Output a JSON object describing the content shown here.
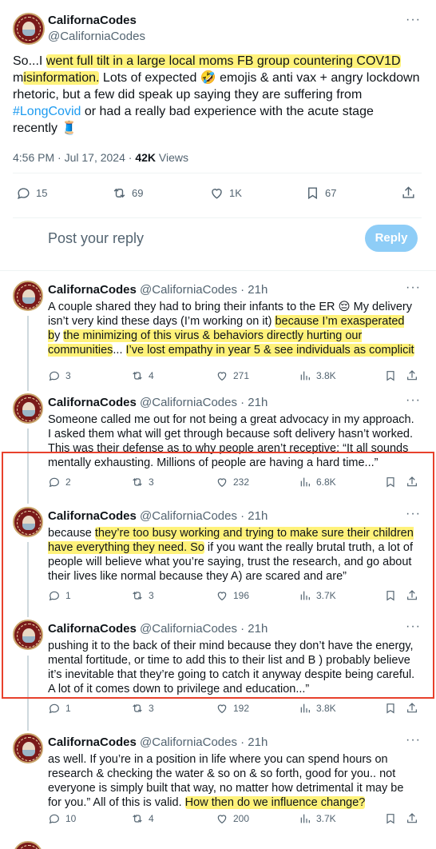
{
  "main_tweet": {
    "name": "CalifornaCodes",
    "handle": "@CaliforniaCodes",
    "text_parts": [
      {
        "t": "So...I ",
        "hl": false
      },
      {
        "t": "went full tilt in a large local moms FB group countering COV1D",
        "hl": true
      },
      {
        "t": " m",
        "hl": false
      },
      {
        "t": "isinformation.",
        "hl": true
      },
      {
        "t": " Lots of expected 🤣 emojis & anti vax + angry lockdown rhetoric, but a few did speak up saying they are suffering from ",
        "hl": false
      },
      {
        "t": "#LongCovid",
        "hl": false,
        "tag": true
      },
      {
        "t": " or had a really bad experience with the acute stage recently 🧵",
        "hl": false
      }
    ],
    "time": "4:56 PM · Jul 17, 2024 · ",
    "views_count": "42K",
    "views_label": " Views",
    "replies": "15",
    "retweets": "69",
    "likes": "1K",
    "bookmarks": "67"
  },
  "reply_box": {
    "placeholder": "Post your reply",
    "button": "Reply"
  },
  "replies": [
    {
      "name": "CalifornaCodes",
      "meta": " @CaliforniaCodes · 21h",
      "parts": [
        {
          "t": "A couple shared they had to bring their infants to the ER 😔 My delivery isn’t very kind these days (I’m working on it) ",
          "hl": false
        },
        {
          "t": "because I’m exasperated b",
          "hl": true
        },
        {
          "t": "y ",
          "hl": false
        },
        {
          "t": "the minimizing of this virus & behaviors directly hurting our communities",
          "hl": true
        },
        {
          "t": "... ",
          "hl": false
        },
        {
          "t": "I’ve lost empathy in year 5 & see individuals as complicit",
          "hl": true
        }
      ],
      "replies": "3",
      "retweets": "4",
      "likes": "271",
      "views": "3.8K"
    },
    {
      "name": "CalifornaCodes",
      "meta": " @CaliforniaCodes · 21h",
      "parts": [
        {
          "t": "Someone called me out for not being a great advocacy in my approach. I asked them what will get through because soft delivery hasn’t worked. This was their defense as to why people aren’t receptive: “It all sounds mentally exhausting. Millions of people are having a hard time...”",
          "hl": false
        }
      ],
      "replies": "2",
      "retweets": "3",
      "likes": "232",
      "views": "6.8K"
    },
    {
      "name": "CalifornaCodes",
      "meta": " @CaliforniaCodes · 21h",
      "parts": [
        {
          "t": "because ",
          "hl": false
        },
        {
          "t": "they’re too busy working and trying to make sure their children have everything they need. So",
          "hl": true
        },
        {
          "t": " if you want the really brutal truth, a lot of people will believe what you’re saying, trust the research, and go about their lives like normal because they A) are scared and are”",
          "hl": false
        }
      ],
      "replies": "1",
      "retweets": "3",
      "likes": "196",
      "views": "3.7K"
    },
    {
      "name": "CalifornaCodes",
      "meta": " @CaliforniaCodes · 21h",
      "parts": [
        {
          "t": "pushing it to the back of their mind because they don’t have the energy, mental fortitude, or time to add this to their list and B ) probably believe it’s inevitable that they’re going to catch it anyway despite being careful. A lot of it comes down to privilege and education...”",
          "hl": false
        }
      ],
      "replies": "1",
      "retweets": "3",
      "likes": "192",
      "views": "3.8K"
    },
    {
      "name": "CalifornaCodes",
      "meta": " @CaliforniaCodes · 21h",
      "parts": [
        {
          "t": "as well. If you’re in a position in life where you can spend hours on research & checking the water & so on & so forth, good for you.. not everyone is simply built that way, no matter how detrimental it may be for you.” All of this is valid. ",
          "hl": false
        },
        {
          "t": "How then do we influence change?",
          "hl": true
        }
      ],
      "replies": "10",
      "retweets": "4",
      "likes": "200",
      "views": "3.7K"
    }
  ],
  "colors": {
    "accent": "#1d9bf0",
    "highlight": "#fff27a",
    "annotation_box": "#e8412c"
  }
}
